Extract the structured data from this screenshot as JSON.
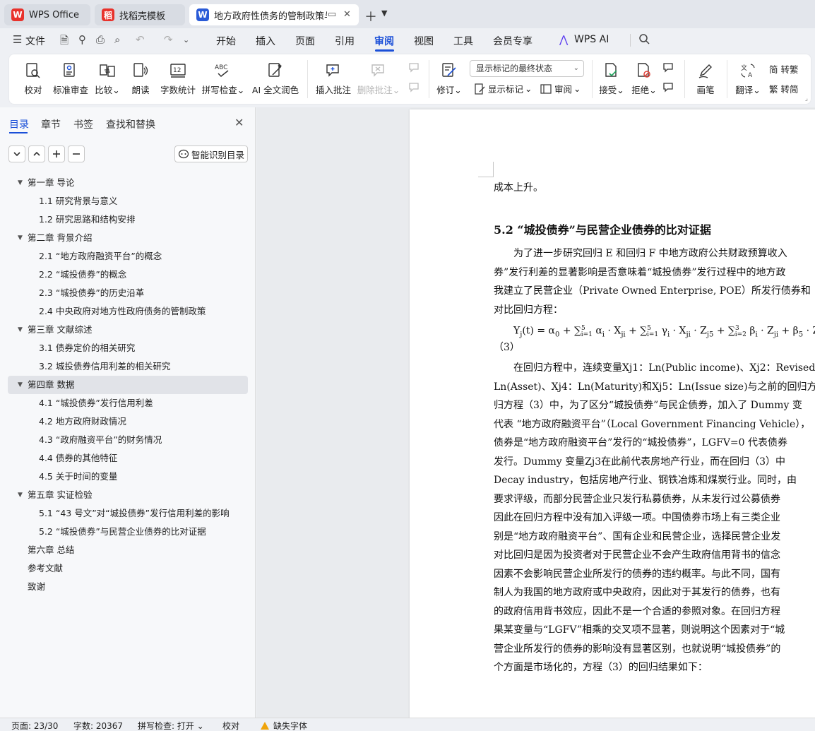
{
  "tabs": [
    {
      "label": "WPS Office",
      "color": "#e8322c"
    },
    {
      "label": "找稻壳模板",
      "color": "#e8322c"
    },
    {
      "label": "地方政府性债务的管制政策与“",
      "color": "#2a5bd7"
    }
  ],
  "menu": {
    "file": "文件",
    "items": [
      "开始",
      "插入",
      "页面",
      "引用",
      "审阅",
      "视图",
      "工具",
      "会员专享"
    ],
    "active": "审阅",
    "wps_ai": "WPS AI"
  },
  "ribbon": {
    "proofread": "校对",
    "std_review": "标准审查",
    "compare": "比较",
    "read_aloud": "朗读",
    "word_count": "字数统计",
    "spell_check": "拼写检查",
    "ai_polish": "AI 全文润色",
    "insert_comment": "插入批注",
    "delete_comment": "删除批注",
    "track_changes": "修订",
    "markup_mode": "显示标记的最终状态",
    "show_markup": "显示标记",
    "review_pane": "审阅",
    "accept": "接受",
    "reject": "拒绝",
    "pen": "画笔",
    "translate": "翻译",
    "to_traditional": "简 转繁",
    "to_simplified": "繁 转简",
    "accent": "#1a4fd8"
  },
  "nav": {
    "tabs": [
      "目录",
      "章节",
      "书签",
      "查找和替换"
    ],
    "smart_toc": "智能识别目录",
    "toc": [
      {
        "level": 1,
        "text": "第一章  导论",
        "expanded": true
      },
      {
        "level": 2,
        "text": "1.1  研究背景与意义"
      },
      {
        "level": 2,
        "text": "1.2  研究思路和结构安排"
      },
      {
        "level": 1,
        "text": "第二章  背景介绍",
        "expanded": true
      },
      {
        "level": 2,
        "text": "2.1 “地方政府融资平台”的概念"
      },
      {
        "level": 2,
        "text": "2.2 “城投债券”的概念"
      },
      {
        "level": 2,
        "text": "2.3 “城投债券”的历史沿革"
      },
      {
        "level": 2,
        "text": "2.4 中央政府对地方性政府债务的管制政策"
      },
      {
        "level": 1,
        "text": "第三章  文献综述",
        "expanded": true
      },
      {
        "level": 2,
        "text": "3.1  债券定价的相关研究"
      },
      {
        "level": 2,
        "text": "3.2  城投债券信用利差的相关研究"
      },
      {
        "level": 1,
        "text": "第四章  数据",
        "expanded": true,
        "selected": true
      },
      {
        "level": 2,
        "text": "4.1 “城投债券”发行信用利差"
      },
      {
        "level": 2,
        "text": "4.2 地方政府财政情况"
      },
      {
        "level": 2,
        "text": "4.3 “政府融资平台”的财务情况"
      },
      {
        "level": 2,
        "text": "4.4 债券的其他特征"
      },
      {
        "level": 2,
        "text": "4.5 关于时间的变量"
      },
      {
        "level": 1,
        "text": "第五章  实证检验",
        "expanded": true
      },
      {
        "level": 2,
        "text": "5.1 “43 号文”对“城投债券”发行信用利差的影响"
      },
      {
        "level": 2,
        "text": "5.2 “城投债券”与民营企业债券的比对证据"
      },
      {
        "level": 1,
        "text": "第六章  总结",
        "expanded": false
      },
      {
        "level": 1,
        "text": "参考文献",
        "expanded": false
      },
      {
        "level": 1,
        "text": "致谢",
        "expanded": false
      }
    ]
  },
  "doc": {
    "line_top": "成本上升。",
    "heading": "5.2 “城投债券”与民营企业债券的比对证据",
    "para1": [
      "　　为了进一步研究回归 E 和回归 F 中地方政府公共财政预算收入",
      "券”发行利差的显著影响是否意味着“城投债券”发行过程中的地方政",
      "我建立了民营企业（Private Owned Enterprise, POE）所发行债券和",
      "对比回归方程："
    ],
    "equation": "　　Yj(t) = α0 + ∑5i=1 αi · Xji + ∑5i=1 γi · Xji · Zj5 + ∑3i=2 βi · Zji + β5 · Z",
    "eq_number": "（3）",
    "para2": [
      "　　在回归方程中，连续变量Xj1：Ln(Public income)、Xj2：Revised",
      "Ln(Asset)、Xj4：Ln(Maturity)和Xj5：Ln(Issue size)与之前的回归方",
      "归方程（3）中，为了区分“城投债券”与民企债券，加入了 Dummy 变",
      "代表 “地方政府融资平台”（Local Government Financing Vehicle），",
      "债券是“地方政府融资平台”发行的“城投债券”，LGFV=0 代表债券",
      "发行。Dummy 变量Zj3在此前代表房地产行业，而在回归（3）中",
      "Decay industry，包括房地产行业、钢铁冶炼和煤炭行业。同时，由",
      "要求评级，而部分民营企业只发行私募债券，从未发行过公募债券",
      "因此在回归方程中没有加入评级一项。中国债券市场上有三类企业",
      "别是“地方政府融资平台”、国有企业和民营企业，选择民营企业发",
      "对比回归是因为投资者对于民营企业不会产生政府信用背书的信念",
      "因素不会影响民营企业所发行的债券的违约概率。与此不同，国有",
      "制人为我国的地方政府或中央政府，因此对于其发行的债券，也有",
      "的政府信用背书效应，因此不是一个合适的参照对象。在回归方程",
      "果某变量与“LGFV”相乘的交叉项不显著，则说明这个因素对于“城",
      "营企业所发行的债券的影响没有显著区别，也就说明“城投债券”的",
      "个方面是市场化的，方程（3）的回归结果如下："
    ]
  },
  "status": {
    "page": "页面: 23/30",
    "words": "字数: 20367",
    "spell": "拼写检查: 打开",
    "proof": "校对",
    "missing_font": "缺失字体"
  }
}
